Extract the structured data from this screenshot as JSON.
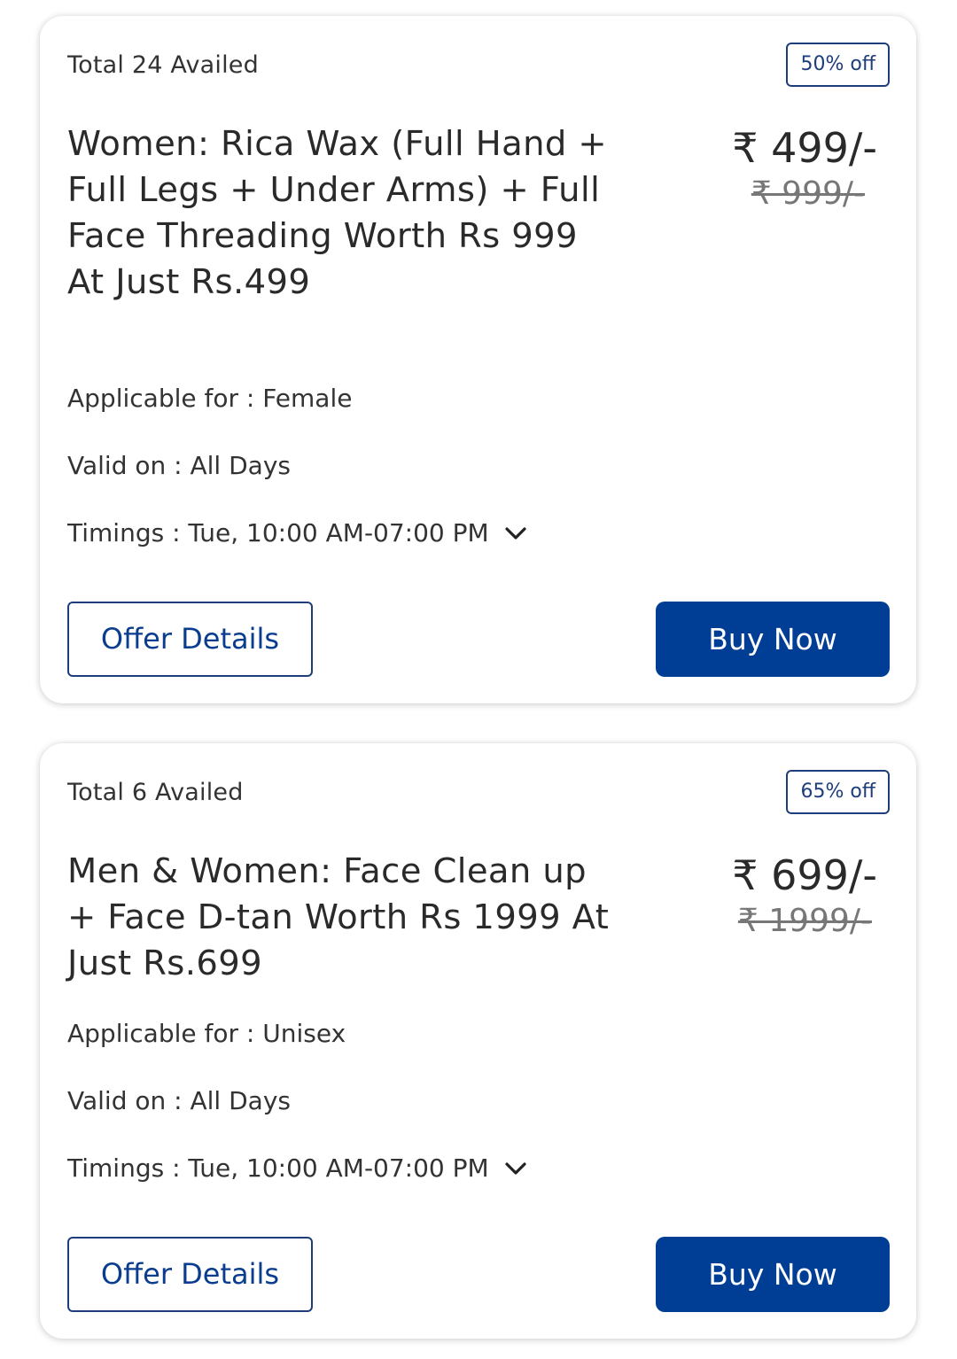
{
  "offers": [
    {
      "availed": "Total 24 Availed",
      "discount": "50% off",
      "title": "Women: Rica Wax (Full Hand + Full Legs + Under Arms) + Full Face Threading Worth Rs 999 At Just Rs.499",
      "price": "₹ 499/-",
      "original_price": "₹ 999/-",
      "applicable_label": "Applicable for : Female",
      "valid_label": "Valid on : All Days",
      "timings_label": "Timings : Tue, 10:00 AM-07:00 PM",
      "offer_details_label": "Offer Details",
      "buy_now_label": "Buy Now"
    },
    {
      "availed": "Total 6 Availed",
      "discount": "65% off",
      "title": "Men & Women: Face Clean up + Face D-tan Worth Rs 1999 At Just Rs.699",
      "price": "₹ 699/-",
      "original_price": "₹ 1999/-",
      "applicable_label": "Applicable for : Unisex",
      "valid_label": "Valid on : All Days",
      "timings_label": "Timings : Tue, 10:00 AM-07:00 PM",
      "offer_details_label": "Offer Details",
      "buy_now_label": "Buy Now"
    }
  ],
  "icons": {
    "timings_expand": "chevron-down-icon"
  },
  "colors": {
    "primary": "#003e96",
    "border": "#1d3e7a"
  }
}
